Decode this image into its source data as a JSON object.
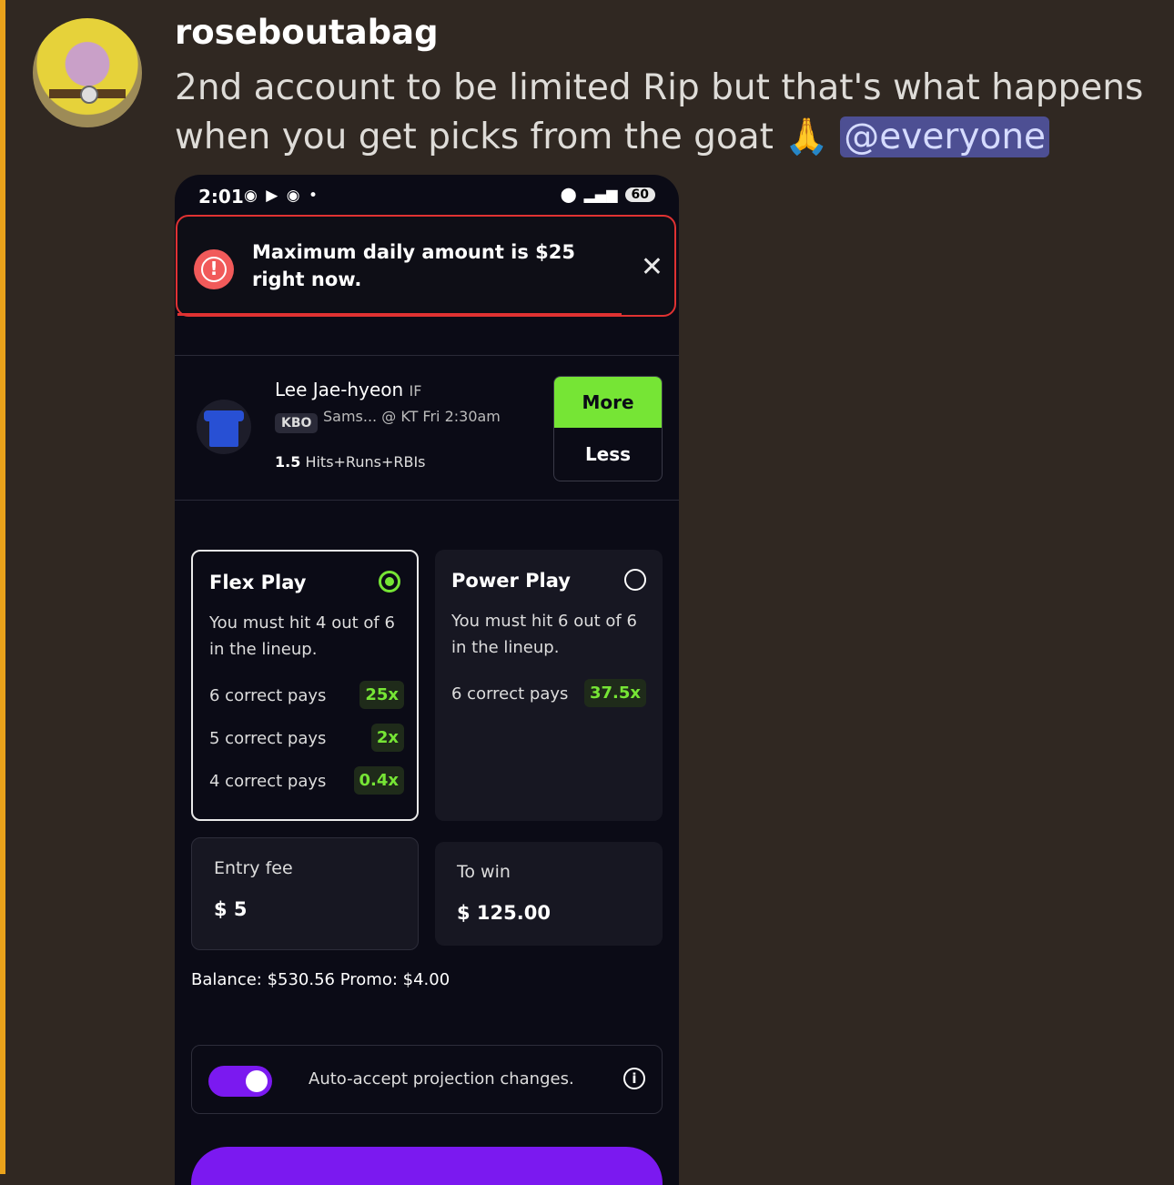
{
  "post": {
    "username": "roseboutabag",
    "message_text": "2nd account to be limited Rip but that's what happens when you get picks from the goat 🙏 ",
    "mention": "@everyone"
  },
  "phone": {
    "status": {
      "time": "2:01",
      "battery": "60"
    },
    "toast": {
      "message": "Maximum daily amount is $25 right now."
    },
    "pick": {
      "player": "Lee Jae-hyeon",
      "position": "IF",
      "league": "KBO",
      "matchup": "Sams... @ KT  Fri 2:30am",
      "stat_value": "1.5",
      "stat_type": "Hits+Runs+RBIs",
      "more_label": "More",
      "less_label": "Less"
    },
    "flex_play": {
      "title": "Flex Play",
      "selected": true,
      "description": "You must hit 4 out of 6 in the lineup.",
      "payouts": [
        {
          "label": "6 correct pays",
          "multiplier": "25x"
        },
        {
          "label": "5 correct pays",
          "multiplier": "2x"
        },
        {
          "label": "4 correct pays",
          "multiplier": "0.4x"
        }
      ]
    },
    "power_play": {
      "title": "Power Play",
      "selected": false,
      "description": "You must hit 6 out of 6 in the lineup.",
      "payouts": [
        {
          "label": "6 correct pays",
          "multiplier": "37.5x"
        }
      ]
    },
    "entry_fee": {
      "label": "Entry fee",
      "value": "$ 5"
    },
    "to_win": {
      "label": "To win",
      "value": "$ 125.00"
    },
    "balance_text": "Balance: $530.56  Promo: $4.00",
    "auto_accept": {
      "label": "Auto-accept projection changes.",
      "enabled": true
    }
  },
  "colors": {
    "accent_green": "#76e535",
    "accent_purple": "#7b19f0",
    "alert_red": "#e03232"
  }
}
